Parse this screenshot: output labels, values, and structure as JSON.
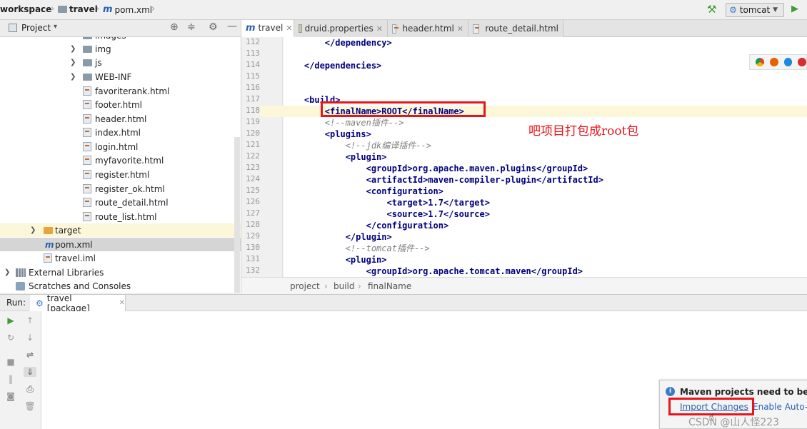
{
  "breadcrumb": {
    "workspace": "workspace",
    "travel": "travel",
    "file": "pom.xml",
    "maven_glyph": "m"
  },
  "run_config": {
    "label": "tomcat"
  },
  "project_panel": {
    "title": "Project",
    "dropdown": "▾"
  },
  "tree": [
    {
      "label": "images",
      "type": "folder"
    },
    {
      "label": "img",
      "type": "folder"
    },
    {
      "label": "js",
      "type": "folder"
    },
    {
      "label": "WEB-INF",
      "type": "folder"
    },
    {
      "label": "favoriterank.html",
      "type": "html"
    },
    {
      "label": "footer.html",
      "type": "html"
    },
    {
      "label": "header.html",
      "type": "html"
    },
    {
      "label": "index.html",
      "type": "html"
    },
    {
      "label": "login.html",
      "type": "html"
    },
    {
      "label": "myfavorite.html",
      "type": "html"
    },
    {
      "label": "register.html",
      "type": "html"
    },
    {
      "label": "register_ok.html",
      "type": "html"
    },
    {
      "label": "route_detail.html",
      "type": "html"
    },
    {
      "label": "route_list.html",
      "type": "html"
    },
    {
      "label": "target",
      "type": "folder-orange"
    },
    {
      "label": "pom.xml",
      "type": "maven"
    },
    {
      "label": "travel.iml",
      "type": "iml"
    },
    {
      "label": "External Libraries",
      "type": "lib"
    },
    {
      "label": "Scratches and Consoles",
      "type": "scratch"
    }
  ],
  "tabs": [
    {
      "label": "travel",
      "glyph": "m"
    },
    {
      "label": "druid.properties"
    },
    {
      "label": "header.html"
    },
    {
      "label": "route_detail.html"
    }
  ],
  "code_lines": [
    {
      "n": "112",
      "text": "        </dependency>"
    },
    {
      "n": "113",
      "text": ""
    },
    {
      "n": "114",
      "text": "    </dependencies>"
    },
    {
      "n": "115",
      "text": ""
    },
    {
      "n": "116",
      "text": ""
    },
    {
      "n": "117",
      "text": "    <build>"
    },
    {
      "n": "118",
      "text": "        <finalName>ROOT</finalName>"
    },
    {
      "n": "119",
      "text": "        <!--maven插件-->"
    },
    {
      "n": "120",
      "text": "        <plugins>"
    },
    {
      "n": "121",
      "text": "            <!--jdk编译插件-->"
    },
    {
      "n": "122",
      "text": "            <plugin>"
    },
    {
      "n": "123",
      "text": "                <groupId>org.apache.maven.plugins</groupId>"
    },
    {
      "n": "124",
      "text": "                <artifactId>maven-compiler-plugin</artifactId>"
    },
    {
      "n": "125",
      "text": "                <configuration>"
    },
    {
      "n": "126",
      "text": "                    <target>1.7</target>"
    },
    {
      "n": "127",
      "text": "                    <source>1.7</source>"
    },
    {
      "n": "128",
      "text": "                </configuration>"
    },
    {
      "n": "129",
      "text": "            </plugin>"
    },
    {
      "n": "130",
      "text": "            <!--tomcat插件-->"
    },
    {
      "n": "131",
      "text": "            <plugin>"
    },
    {
      "n": "132",
      "text": "                <groupId>org.apache.tomcat.maven</groupId>"
    }
  ],
  "annotation": "吧项目打包成root包",
  "editor_breadcrumb": [
    "project",
    "build",
    "finalName"
  ],
  "run": {
    "label": "Run:",
    "config": "travel [package]"
  },
  "notification": {
    "title": "Maven projects need to be imp",
    "import": "Import Changes",
    "auto": "Enable Auto-I"
  },
  "watermark": "CSDN @山人怪223",
  "colors": {
    "red_box": "#e8141a",
    "tag": "#000080",
    "comment": "#808080",
    "highlight": "#fcf7d8"
  }
}
